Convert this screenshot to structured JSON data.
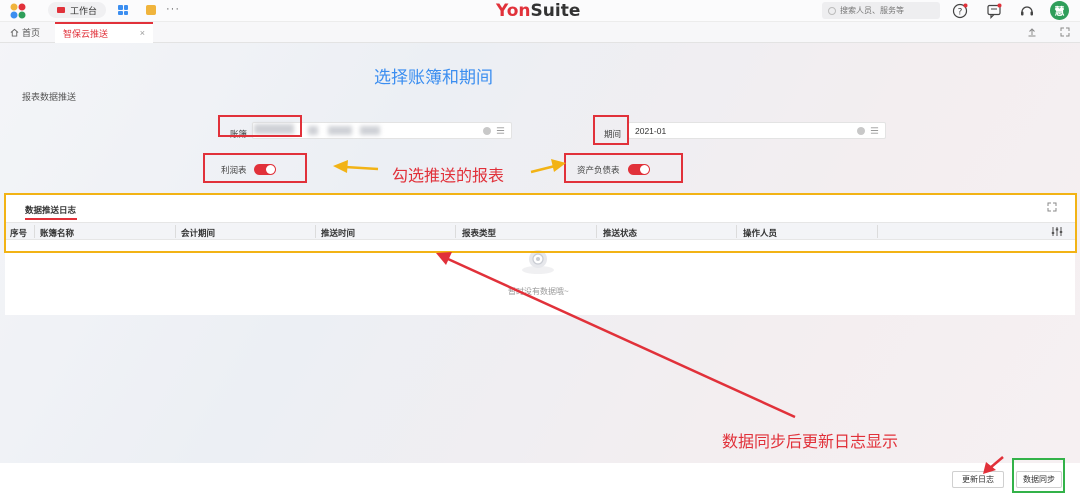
{
  "topbar": {
    "workspace_label": "工作台",
    "more": "···",
    "brand_a": "Yon",
    "brand_b": "Suite",
    "search_placeholder": "搜索人员、服务等",
    "avatar_text": "慧"
  },
  "tabs": {
    "home": "首页",
    "active": "智保云推送",
    "close": "×"
  },
  "page": {
    "title": "报表数据推送",
    "book_label": "账簿",
    "period_label": "期间",
    "period_value": "2021-01",
    "profit_toggle_label": "利润表",
    "balance_toggle_label": "资产负债表",
    "profit_toggle_on": true,
    "balance_toggle_on": true
  },
  "log": {
    "title": "数据推送日志",
    "columns": [
      "序号",
      "账簿名称",
      "会计期间",
      "推送时间",
      "报表类型",
      "推送状态",
      "操作人员"
    ],
    "empty_text": "暂时没有数据哦~"
  },
  "footer": {
    "refresh_log": "更新日志",
    "sync_data": "数据同步"
  },
  "annotations": {
    "select_title": "选择账簿和期间",
    "check_tip": "勾选推送的报表",
    "sync_tip": "数据同步后更新日志显示"
  },
  "colors": {
    "accent": "#e1313a",
    "annotation_blue": "#3b8ef0",
    "highlight_yellow": "#f2b315",
    "highlight_green": "#33b249"
  }
}
